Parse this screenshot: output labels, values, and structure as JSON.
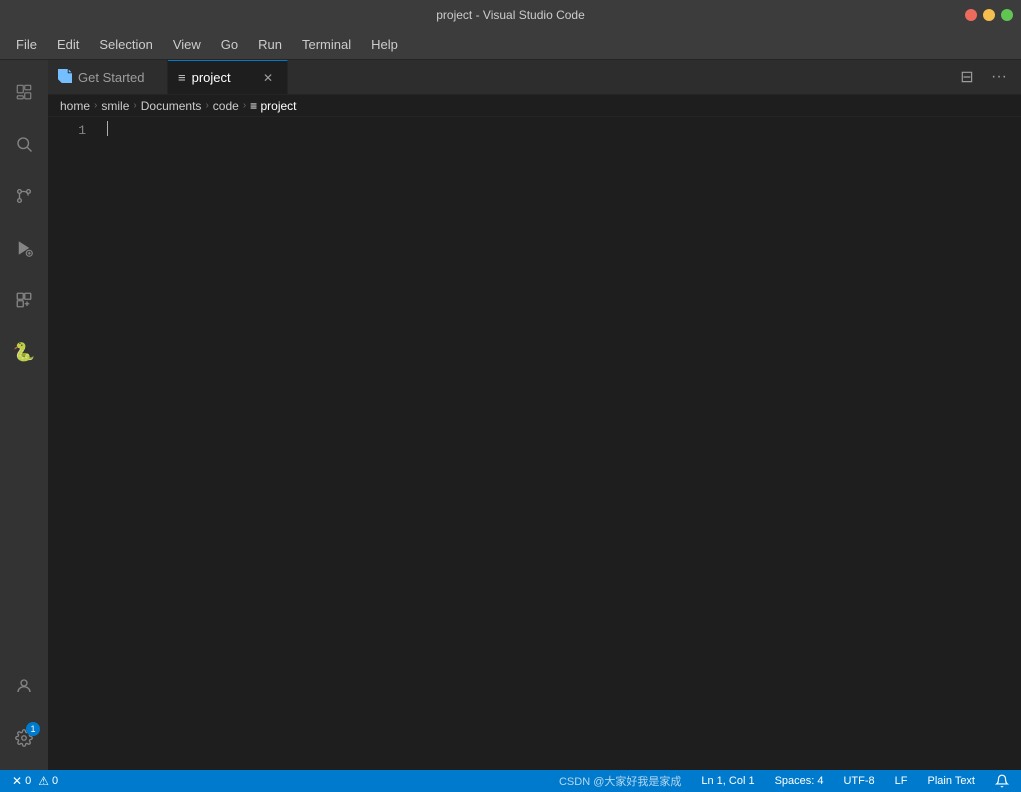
{
  "window": {
    "title": "project - Visual Studio Code"
  },
  "menu": {
    "items": [
      "File",
      "Edit",
      "Selection",
      "View",
      "Go",
      "Run",
      "Terminal",
      "Help"
    ]
  },
  "tabs": [
    {
      "label": "Get Started",
      "icon": "vscode",
      "active": false,
      "closable": false
    },
    {
      "label": "project",
      "icon": "text-file",
      "active": true,
      "closable": true
    }
  ],
  "breadcrumb": {
    "items": [
      "home",
      "smile",
      "Documents",
      "code",
      "project"
    ]
  },
  "editor": {
    "line_numbers": [
      "1"
    ],
    "content_line1": ""
  },
  "status_bar": {
    "errors": "0",
    "warnings": "0",
    "position": "Ln 1, Col 1",
    "spaces": "Spaces: 4",
    "encoding": "UTF-8",
    "line_ending": "LF",
    "language": "Plain Text",
    "watermark": "CSDN @大家好我是家成",
    "notification_count": "1"
  },
  "activity_bar": {
    "icons": [
      {
        "name": "explorer-icon",
        "symbol": "📄",
        "active": false
      },
      {
        "name": "search-icon",
        "symbol": "🔍",
        "active": false
      },
      {
        "name": "source-control-icon",
        "symbol": "⑂",
        "active": false
      },
      {
        "name": "run-debug-icon",
        "symbol": "▷",
        "active": false
      },
      {
        "name": "extensions-icon",
        "symbol": "⊞",
        "active": false
      },
      {
        "name": "python-icon",
        "symbol": "🐍",
        "active": false
      }
    ]
  }
}
